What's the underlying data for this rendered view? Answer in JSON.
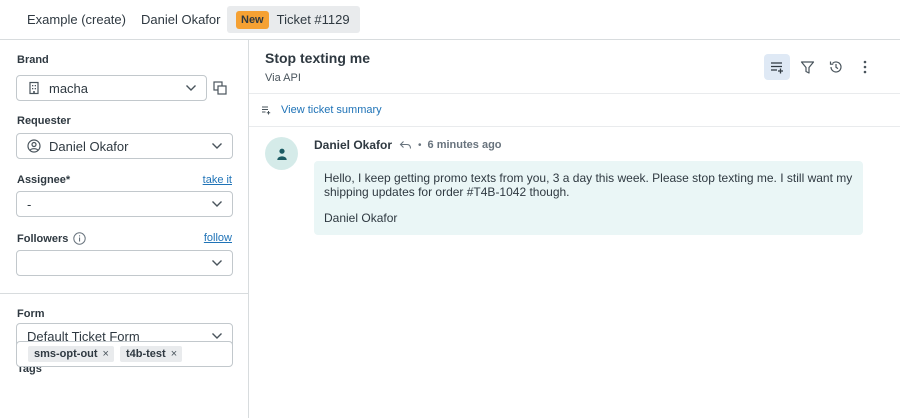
{
  "tabs": [
    {
      "label": "Example (create)"
    },
    {
      "label": "Daniel Okafor"
    },
    {
      "badge": "New",
      "label": "Ticket #1129"
    }
  ],
  "sidebar": {
    "brand": {
      "label": "Brand",
      "value": "macha"
    },
    "requester": {
      "label": "Requester",
      "value": "Daniel Okafor"
    },
    "assignee": {
      "label": "Assignee*",
      "link": "take it",
      "value": "-"
    },
    "followers": {
      "label": "Followers",
      "link": "follow",
      "value": ""
    },
    "form": {
      "label": "Form",
      "value": "Default Ticket Form"
    },
    "tags": {
      "label": "Tags",
      "items": [
        "sms-opt-out",
        "t4b-test"
      ],
      "remove_glyph": "×"
    }
  },
  "ticket": {
    "subject": "Stop texting me",
    "channel": "Via API",
    "summary_link": "View ticket summary"
  },
  "toolbar": {
    "icons": [
      "conversation-list-icon",
      "filter-icon",
      "history-icon",
      "more-vertical-icon"
    ]
  },
  "message": {
    "author": "Daniel Okafor",
    "separator": "•",
    "time": "6 minutes ago",
    "body": "Hello, I keep getting promo texts from you, 3 a day this week. Please stop texting me. I still want my shipping updates for order #T4B-1042 though.",
    "signature": "Daniel Okafor"
  },
  "colors": {
    "accent": "#1f73b7",
    "new_badge": "#f5a133",
    "bubble": "#eaf6f6",
    "avatar": "#d5ebe9",
    "active_tool": "#dfe9f5"
  }
}
